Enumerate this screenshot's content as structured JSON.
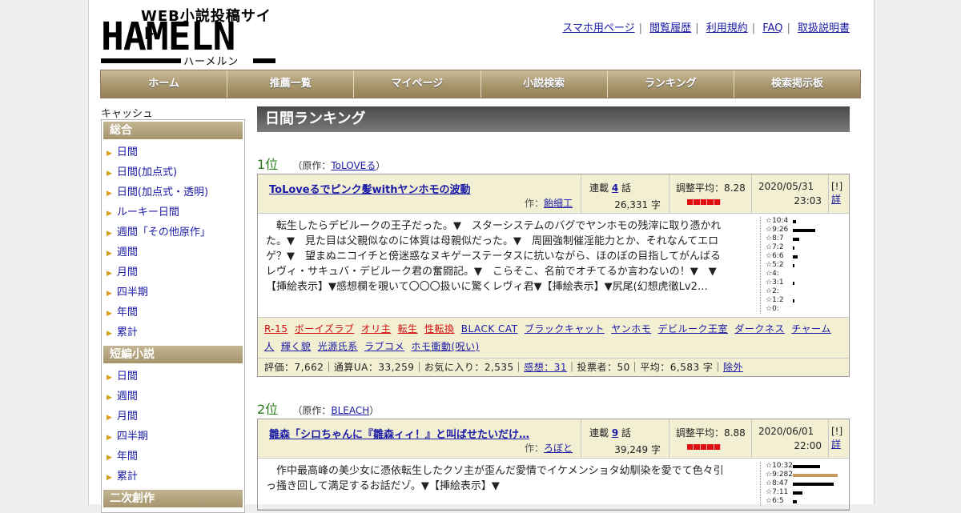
{
  "logo": {
    "main": "HAMELN",
    "subtitle": "WEB小説投稿サイト",
    "kana": "ハーメルン"
  },
  "toplinks": [
    "スマホ用ページ",
    "閲覧履歴",
    "利用規約",
    "FAQ",
    "取扱説明書"
  ],
  "nav": [
    "ホーム",
    "推薦一覧",
    "マイページ",
    "小説検索",
    "ランキング",
    "検索掲示板"
  ],
  "sidebar": {
    "cache_label": "キャッシュ",
    "sections": [
      {
        "title": "総合",
        "items": [
          "日間",
          "日間(加点式)",
          "日間(加点式・透明)",
          "ルーキー日間",
          "週間「その他原作」",
          "週間",
          "月間",
          "四半期",
          "年間",
          "累計"
        ]
      },
      {
        "title": "短編小説",
        "items": [
          "日間",
          "週間",
          "月間",
          "四半期",
          "年間",
          "累計"
        ]
      },
      {
        "title": "二次創作",
        "items": []
      }
    ]
  },
  "main": {
    "title": "日間ランキング",
    "entries": [
      {
        "rank": "1位",
        "orig_prefix": "（原作：",
        "orig": "ToLOVEる",
        "orig_suffix": "）",
        "title": "ToLoveるでピンク髪withヤンホモの波動",
        "author_prefix": "作：",
        "author": "飴細工",
        "serial_prefix": "連載 ",
        "episodes": "4",
        "serial_suffix": " 話",
        "chars": "26,331 字",
        "rating": "調整平均：8.28",
        "rating_value": 8.28,
        "date": "2020/05/31",
        "time": "23:03",
        "link1": "[!]",
        "link2": "詳",
        "summary": "転生したらデビルークの王子だった。▼　スターシステムのバグでヤンホモの残滓に取り憑かれた。▼　見た目は父親似なのに体質は母親似だった。▼　周囲強制催淫能力とか、それなんてエロゲ？▼　望まぬニコイチと傍迷惑なヌキゲーステータスに抗いながら、ほのぼの目指してがんばるレヴィ・サキュバ・デビルーク君の奮闘記。▼　こらそこ、名前でオチてるか言わないの！▼　▼【挿絵表示】▼感想欄を覗いて〇〇〇扱いに驚くレヴィ君▼【挿絵表示】▼尻尾(幻想虎徹Lv2…",
        "votes": [
          {
            "label": "☆10:4",
            "value": 4,
            "color": "#000000"
          },
          {
            "label": "☆9:26",
            "value": 26,
            "color": "#000000"
          },
          {
            "label": "☆8:7",
            "value": 7,
            "color": "#000000"
          },
          {
            "label": "☆7:2",
            "value": 2,
            "color": "#000000"
          },
          {
            "label": "☆6:6",
            "value": 6,
            "color": "#000000"
          },
          {
            "label": "☆5:2",
            "value": 2,
            "color": "#000000"
          },
          {
            "label": "☆4:",
            "value": 0,
            "color": "#000000"
          },
          {
            "label": "☆3:1",
            "value": 1,
            "color": "#000000"
          },
          {
            "label": "☆2:",
            "value": 0,
            "color": "#000000"
          },
          {
            "label": "☆1:2",
            "value": 2,
            "color": "#000000"
          },
          {
            "label": "☆0:",
            "value": 0,
            "color": "#000000"
          }
        ],
        "tags_red": [
          "R-15",
          "ボーイズラブ",
          "オリ主",
          "転生",
          "性転換"
        ],
        "tags": [
          "BLACK CAT",
          "ブラックキャット",
          "ヤンホモ",
          "デビルーク王室",
          "ダークネス",
          "チャーム人",
          "輝く貌",
          "光源氏系",
          "ラブコメ",
          "ホモ衝動(呪い)"
        ],
        "stats_a": "評価：7,662｜通算UA：33,259｜お気に入り：2,535｜",
        "stats_link": "感想：31",
        "stats_b": "｜投票者：50｜平均：6,583 字｜",
        "stats_link2": "除外"
      },
      {
        "rank": "2位",
        "orig_prefix": "（原作：",
        "orig": "BLEACH",
        "orig_suffix": "）",
        "title": "雛森「シロちゃんに『雛森ィィ！』と叫ばせたいだけ…",
        "author_prefix": "作：",
        "author": "ろぼと",
        "serial_prefix": "連載 ",
        "episodes": "9",
        "serial_suffix": " 話",
        "chars": "39,249 字",
        "rating": "調整平均：8.88",
        "rating_value": 8.88,
        "date": "2020/06/01",
        "time": "22:00",
        "link1": "[!]",
        "link2": "詳",
        "summary": "作中最高峰の美少女に憑依転生したクソ主が歪んだ愛情でイケメンショタ幼馴染を愛でて色々引っ掻き回して満足するお話だゾ。▼【挿絵表示】▼",
        "votes": [
          {
            "label": "☆10:32",
            "value": 32,
            "color": "#000000"
          },
          {
            "label": "☆9:282",
            "value": 52,
            "color": "#c89a60"
          },
          {
            "label": "☆8:47",
            "value": 47,
            "color": "#000000"
          },
          {
            "label": "☆7:11",
            "value": 11,
            "color": "#000000"
          },
          {
            "label": "☆6:5",
            "value": 5,
            "color": "#000000"
          }
        ]
      }
    ]
  }
}
